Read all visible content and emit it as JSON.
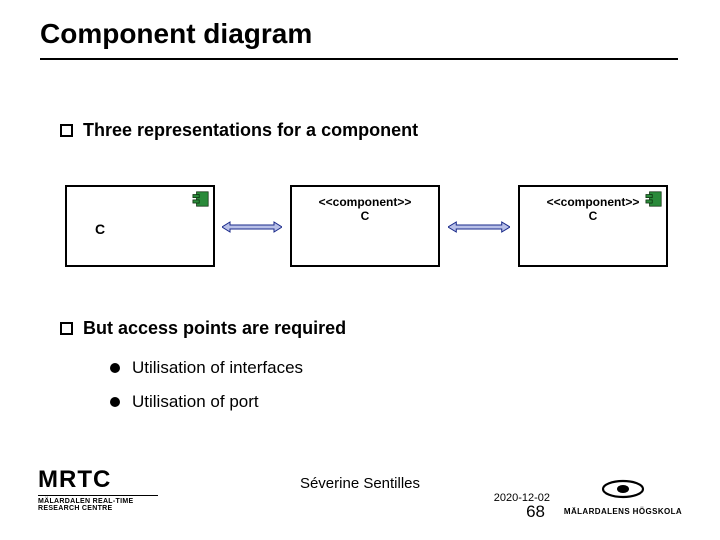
{
  "title": "Component diagram",
  "bullets": {
    "three_reps": "Three representations for a component",
    "access_points": "But access points are required",
    "sub_interfaces": "Utilisation of interfaces",
    "sub_port": "Utilisation of port"
  },
  "boxes": {
    "box1_label": "C",
    "box2_stereo": "<<component>>",
    "box2_label": "C",
    "box3_stereo": "<<component>>",
    "box3_label": "C"
  },
  "footer": {
    "mrtc": "MRTC",
    "mrtc_sub": "MÄLARDALEN REAL-TIME RESEARCH CENTRE",
    "author": "Séverine Sentilles",
    "date": "2020-12-02",
    "page": "68",
    "mdh": "MÄLARDALENS HÖGSKOLA"
  },
  "colors": {
    "comp_icon": "#2a8a3a",
    "arrow_stroke": "#1a2a8a",
    "arrow_fill": "#b8c0e8"
  }
}
